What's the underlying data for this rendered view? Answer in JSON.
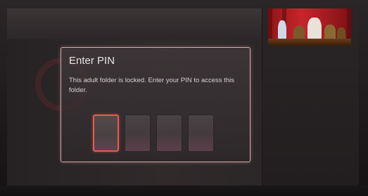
{
  "dialog": {
    "title": "Enter PIN",
    "message": "This adult folder is locked. Enter your PIN to access this folder.",
    "pin_digit_count": 4,
    "active_index": 0
  },
  "colors": {
    "dialog_border": "#d9a9ad",
    "active_pin_border": "#e35b4c",
    "background": "#1b1819"
  },
  "icons": [
    "movie-thumbnail"
  ]
}
